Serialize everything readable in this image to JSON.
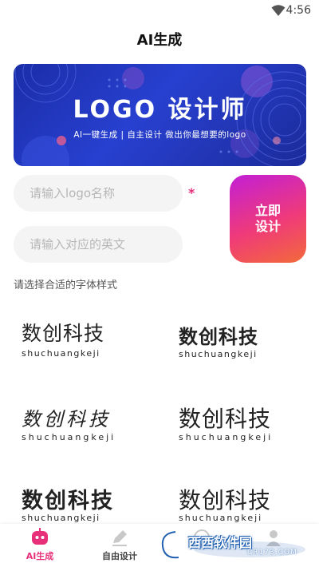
{
  "status_bar": {
    "time": "4:56",
    "wifi_icon": "wifi-icon"
  },
  "header": {
    "title": "AI生成"
  },
  "banner": {
    "title": "LOGO 设计师",
    "subtitle": "AI一键生成 | 自主设计    做出你最想要的logo"
  },
  "form": {
    "name_placeholder": "请输入logo名称",
    "name_value": "",
    "required_mark": "*",
    "english_placeholder": "请输入对应的英文",
    "english_value": "",
    "generate_label": "立即设计",
    "font_hint": "请选择合适的字体样式"
  },
  "font_samples": [
    {
      "text": "数创科技",
      "pinyin": "shuchuangkeji"
    },
    {
      "text": "数创科技",
      "pinyin": "shuchuangkeji"
    },
    {
      "text": "数创科技",
      "pinyin": "shuchuangkeji"
    },
    {
      "text": "数创科技",
      "pinyin": "shuchuangkeji"
    },
    {
      "text": "数创科技",
      "pinyin": "shuchuangkeji"
    },
    {
      "text": "数创科技",
      "pinyin": "shuchuangkeji"
    }
  ],
  "bottom_nav": {
    "items": [
      {
        "label": "AI生成",
        "icon": "robot-icon",
        "active": true
      },
      {
        "label": "自由设计",
        "icon": "pen-icon",
        "active": false
      },
      {
        "label": "",
        "icon": "brush-icon",
        "active": false
      },
      {
        "label": "",
        "icon": "user-icon",
        "active": false
      }
    ]
  },
  "watermark": {
    "text": "西西软件园",
    "sub": "CR173.COM"
  },
  "colors": {
    "accent": "#e8307a",
    "banner_blue": "#2840d0",
    "gradient_start": "#c21fd6",
    "gradient_end": "#f36a3a"
  }
}
